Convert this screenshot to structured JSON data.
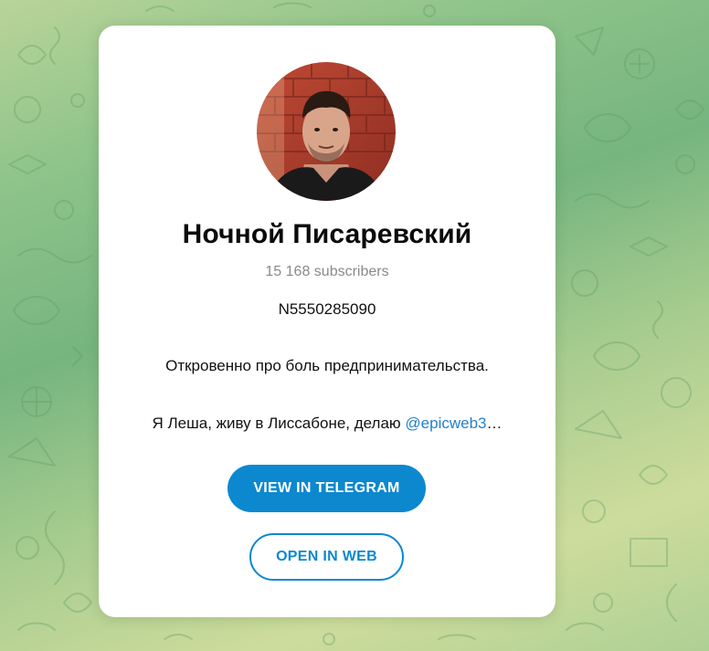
{
  "channel": {
    "title": "Ночной Писаревский",
    "subscribers": "15 168 subscribers",
    "description": {
      "id_line": "N5550285090",
      "about_line": "Откровенно про боль предпринимательства.",
      "intro_prefix": "Я Леша, живу в Лиссабоне, делаю ",
      "intro_link": "@epicweb3",
      "intro_suffix": "…"
    },
    "avatar_alt": "channel avatar"
  },
  "actions": {
    "view_in_telegram": "VIEW IN TELEGRAM",
    "open_in_web": "OPEN IN WEB"
  },
  "colors": {
    "accent": "#0c88cf",
    "link": "#2481cc",
    "background_green": "#8fc48a",
    "card": "#ffffff"
  },
  "icons": {
    "background": "doodle-pattern"
  }
}
